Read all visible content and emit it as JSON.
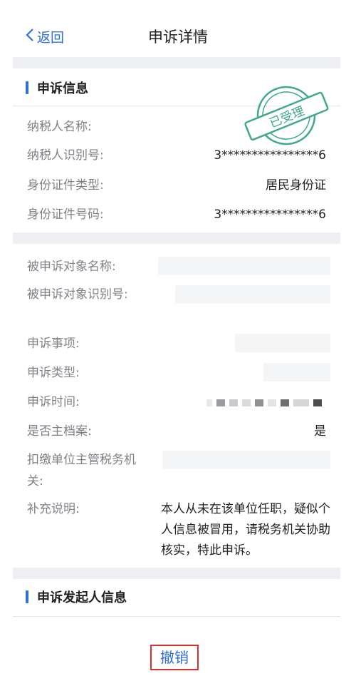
{
  "nav": {
    "back_label": "返回",
    "title": "申诉详情"
  },
  "section1": {
    "heading": "申诉信息",
    "stamp_text": "已受理"
  },
  "taxpayer": {
    "name_label": "纳税人名称:",
    "id_label": "纳税人识别号:",
    "id_value": "3****************6",
    "doc_type_label": "身份证件类型:",
    "doc_type_value": "居民身份证",
    "doc_no_label": "身份证件号码:",
    "doc_no_value": "3****************6"
  },
  "complaint": {
    "target_name_label": "被申诉对象名称:",
    "target_id_label": "被申诉对象识别号:",
    "matter_label": "申诉事项:",
    "type_label": "申诉类型:",
    "time_label": "申诉时间:",
    "main_file_label": "是否主档案:",
    "main_file_value": "是",
    "authority_label": "扣缴单位主管税务机关:",
    "note_label": "补充说明:",
    "note_value": "本人从未在该单位任职，疑似个人信息被冒用，请税务机关协助核实，特此申诉。"
  },
  "section2": {
    "heading": "申诉发起人信息"
  },
  "actions": {
    "cancel_label": "撤销"
  }
}
